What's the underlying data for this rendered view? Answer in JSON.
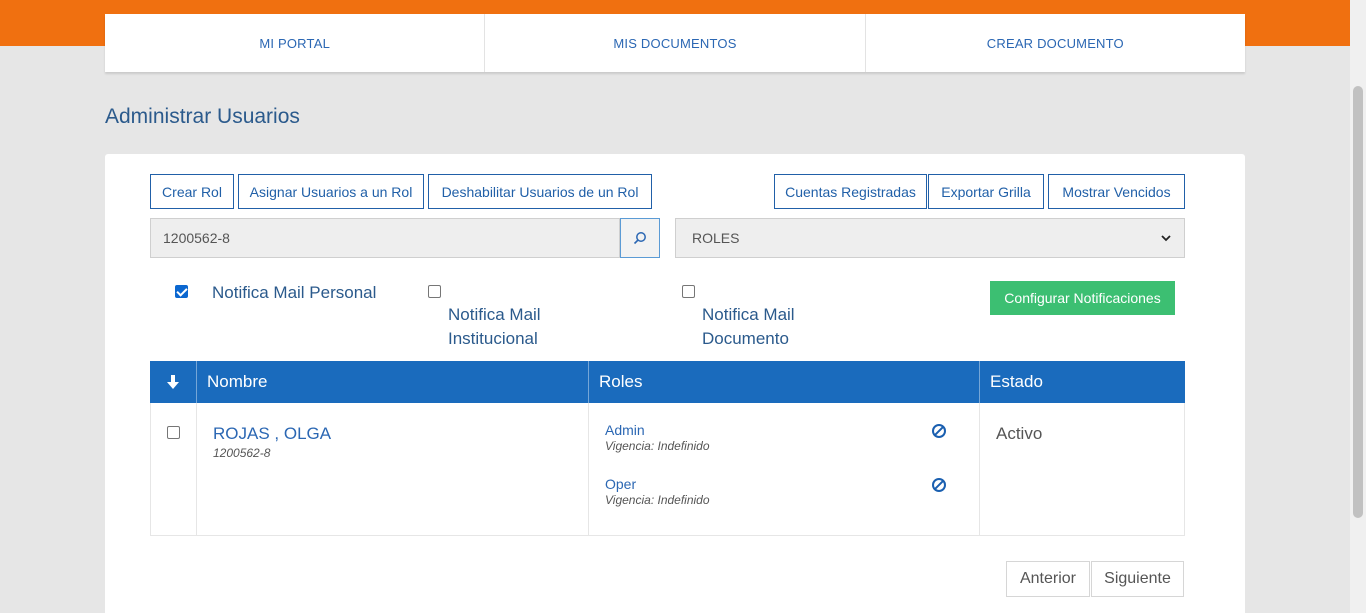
{
  "colors": {
    "accent_orange": "#f07010",
    "primary_blue": "#1a6bbd",
    "green": "#3cbf72"
  },
  "nav": {
    "items": [
      {
        "label": "MI PORTAL"
      },
      {
        "label": "MIS DOCUMENTOS"
      },
      {
        "label": "CREAR DOCUMENTO"
      }
    ]
  },
  "page": {
    "title": "Administrar Usuarios"
  },
  "toolbar": {
    "crear_rol": "Crear Rol",
    "asignar": "Asignar Usuarios a un Rol",
    "deshabilitar": "Deshabilitar Usuarios de un Rol",
    "cuentas": "Cuentas Registradas",
    "exportar": "Exportar Grilla",
    "vencidos": "Mostrar Vencidos"
  },
  "search": {
    "value": "1200562-8",
    "icon": "search-icon"
  },
  "roles_select": {
    "selected": "ROLES"
  },
  "notifications": {
    "personal": {
      "label": "Notifica Mail Personal",
      "checked": true
    },
    "institucional": {
      "line1": "Notifica Mail",
      "line2": "Institucional",
      "checked": false
    },
    "documento": {
      "line1": "Notifica Mail",
      "line2": "Documento",
      "checked": false
    },
    "configure_label": "Configurar Notificaciones"
  },
  "table": {
    "headers": {
      "sort_icon": "arrow-down-icon",
      "nombre": "Nombre",
      "roles": "Roles",
      "estado": "Estado"
    },
    "rows": [
      {
        "name": "ROJAS , OLGA",
        "id": "1200562-8",
        "roles": [
          {
            "name": "Admin",
            "vigencia": "Vigencia: Indefinido"
          },
          {
            "name": "Oper",
            "vigencia": "Vigencia: Indefinido"
          }
        ],
        "estado": "Activo"
      }
    ]
  },
  "pagination": {
    "prev": "Anterior",
    "next": "Siguiente"
  }
}
